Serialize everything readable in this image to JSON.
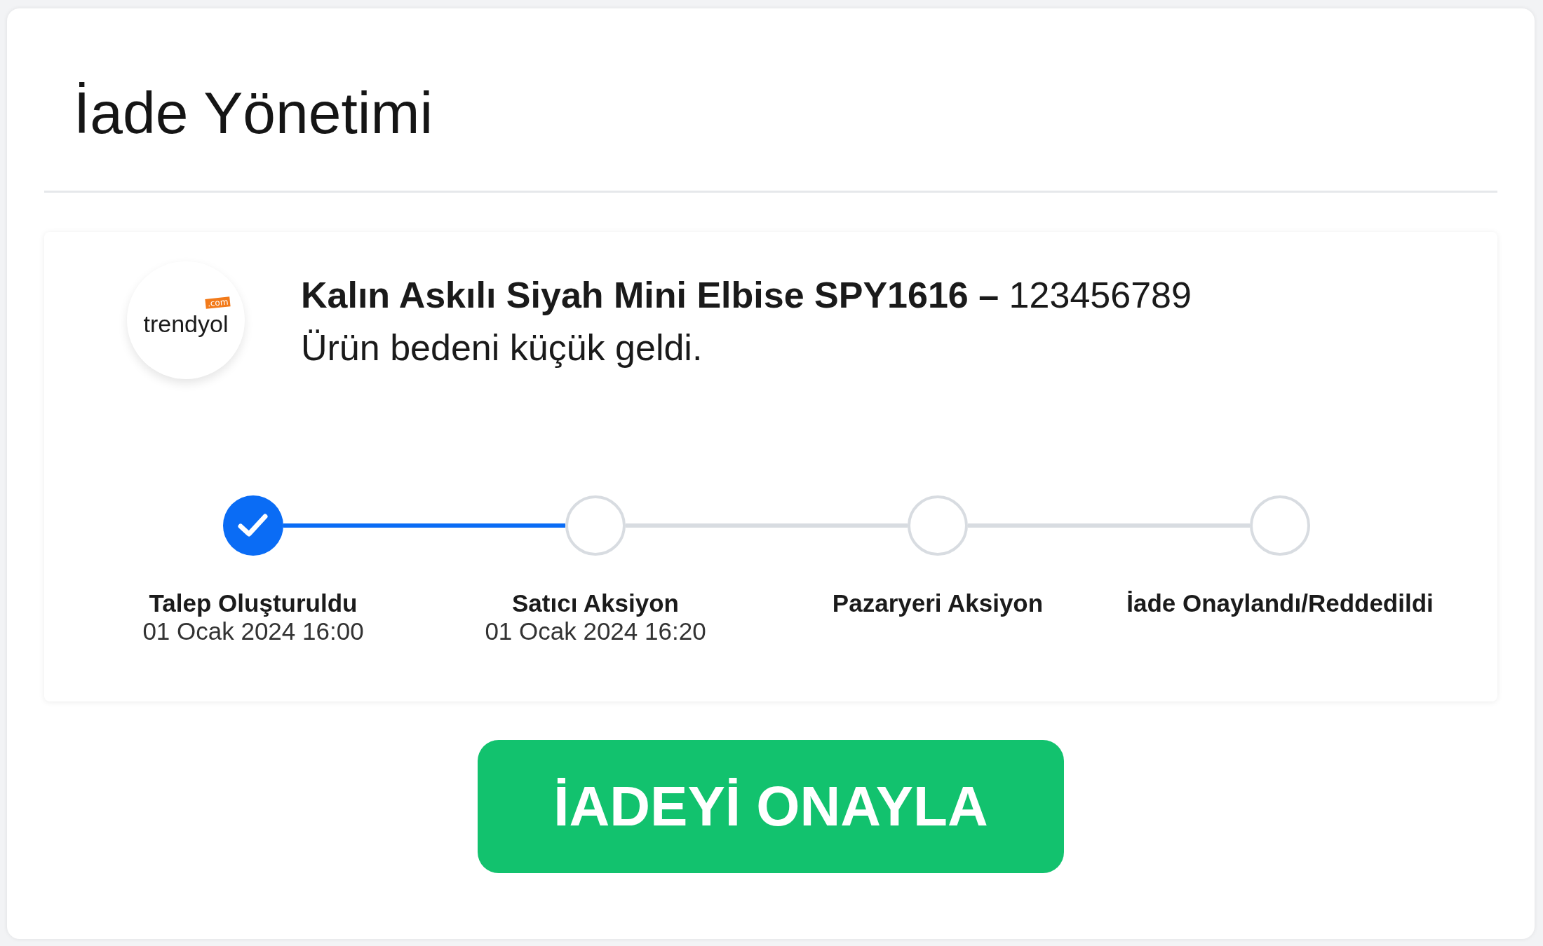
{
  "title": "İade Yönetimi",
  "logo": {
    "text": "trendyol",
    "badge": ".com"
  },
  "product": {
    "name": "Kalın Askılı Siyah Mini Elbise SPY1616 –",
    "code": "123456789",
    "reason": "Ürün bedeni küçük geldi."
  },
  "steps": [
    {
      "label": "Talep Oluşturuldu",
      "date": "01 Ocak 2024 16:00",
      "done": true
    },
    {
      "label": "Satıcı Aksiyon",
      "date": "01 Ocak 2024 16:20",
      "done": false
    },
    {
      "label": "Pazaryeri Aksiyon",
      "done": false
    },
    {
      "label": "İade Onaylandı/Reddedildi",
      "done": false
    }
  ],
  "button": "İADEYİ ONAYLA"
}
